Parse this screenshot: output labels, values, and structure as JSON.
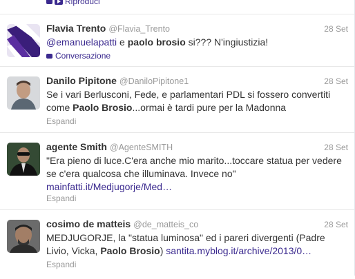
{
  "top": {
    "action_label": "Riproduci"
  },
  "tweets": [
    {
      "fullname": "Flavia Trento",
      "screen": "@Flavia_Trento",
      "time": "28 Set",
      "mention": "@emanuelapatti",
      "t1": " e ",
      "hl1": "paolo brosio",
      "t2": " si??? N'ingiustizia!",
      "foot": "Conversazione"
    },
    {
      "fullname": "Danilo Pipitone",
      "screen": "@DaniloPipitone1",
      "time": "28 Set",
      "t1": "Se i vari Berlusconi, Fede, e parlamentari PDL si fossero convertiti come ",
      "hl1": "Paolo Brosio",
      "t2": "...ormai è tardi pure per la Madonna",
      "foot": "Espandi"
    },
    {
      "fullname": "agente Smith",
      "screen": "@AgenteSMITH",
      "time": "28 Set",
      "t1": "\"Era pieno di luce.C'era anche mio marito...toccare statua per vedere se c'era qualcosa che illuminava. Invece no\"",
      "link": "mainfatti.it/Medjugorje/Med…",
      "foot": "Espandi"
    },
    {
      "fullname": "cosimo de matteis",
      "screen": "@de_matteis_co",
      "time": "28 Set",
      "t1": "MEDJUGORJE, la \"statua luminosa\" ed i pareri divergenti (Padre Livio, Vicka, ",
      "hl1": "Paolo Brosio",
      "t2": ") ",
      "link": "santita.myblog.it/archive/2013/0…",
      "foot": "Espandi"
    }
  ]
}
